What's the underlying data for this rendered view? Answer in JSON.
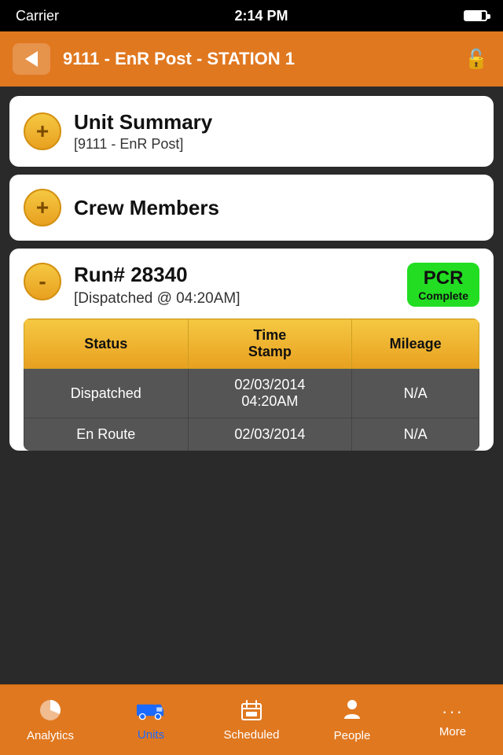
{
  "statusBar": {
    "carrier": "Carrier",
    "time": "2:14 PM"
  },
  "header": {
    "title": "9111 - EnR Post - STATION 1",
    "backLabel": "back",
    "lockIcon": "🔓"
  },
  "unitSummary": {
    "expandSymbol": "+",
    "title": "Unit Summary",
    "subtitle": "[9111 - EnR Post]"
  },
  "crewMembers": {
    "expandSymbol": "+",
    "title": "Crew Members"
  },
  "run": {
    "expandSymbol": "-",
    "title": "Run# 28340",
    "subtitle": "[Dispatched @ 04:20AM]",
    "pcrLabel": "PCR",
    "pcrStatus": "Complete"
  },
  "table": {
    "headers": [
      "Status",
      "Time\nStamp",
      "Mileage"
    ],
    "rows": [
      {
        "status": "Dispatched",
        "timestamp": "02/03/2014\n04:20AM",
        "mileage": "N/A"
      },
      {
        "status": "En Route",
        "timestamp": "02/03/2014",
        "mileage": "N/A"
      }
    ]
  },
  "bottomNav": {
    "items": [
      {
        "id": "analytics",
        "label": "Analytics",
        "active": false
      },
      {
        "id": "units",
        "label": "Units",
        "active": true
      },
      {
        "id": "scheduled",
        "label": "Scheduled",
        "active": false
      },
      {
        "id": "people",
        "label": "People",
        "active": false
      },
      {
        "id": "more",
        "label": "More",
        "active": false
      }
    ]
  }
}
